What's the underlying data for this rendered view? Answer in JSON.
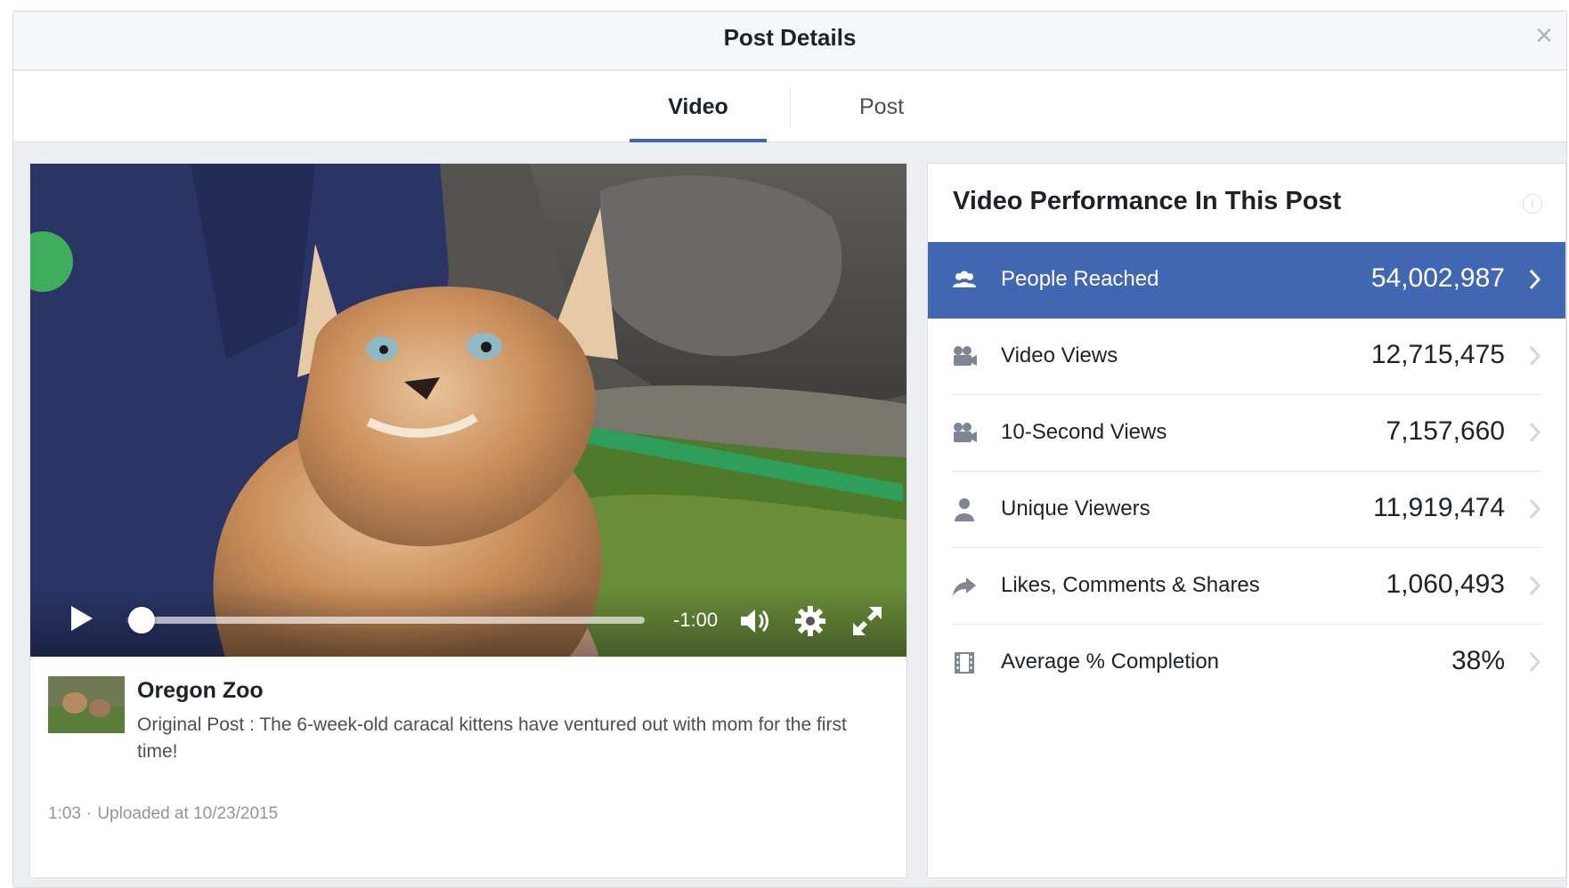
{
  "dialog": {
    "title": "Post Details",
    "close_glyph": "×"
  },
  "tabs": [
    {
      "label": "Video",
      "selected": true
    },
    {
      "label": "Post",
      "selected": false
    }
  ],
  "video_player": {
    "time_remaining": "-1:00",
    "progress_fraction": 0.03,
    "icons": [
      "play-icon",
      "volume-icon",
      "gear-icon",
      "fullscreen-icon"
    ]
  },
  "post": {
    "author": "Oregon Zoo",
    "text": "Original Post : The 6-week-old caracal kittens have ventured out with mom for the first time!",
    "duration": "1:03",
    "separator": "·",
    "uploaded": "Uploaded at 10/23/2015"
  },
  "performance": {
    "title": "Video Performance In This Post",
    "info_glyph": "i",
    "accent_color": "#4267b2",
    "metrics": [
      {
        "icon": "people-icon",
        "label": "People Reached",
        "value": "54,002,987",
        "active": true
      },
      {
        "icon": "video-camera-icon",
        "label": "Video Views",
        "value": "12,715,475",
        "active": false
      },
      {
        "icon": "video-camera-icon",
        "label": "10-Second Views",
        "value": "7,157,660",
        "active": false
      },
      {
        "icon": "person-icon",
        "label": "Unique Viewers",
        "value": "11,919,474",
        "active": false
      },
      {
        "icon": "share-icon",
        "label": "Likes, Comments & Shares",
        "value": "1,060,493",
        "active": false
      },
      {
        "icon": "film-icon",
        "label": "Average % Completion",
        "value": "38%",
        "active": false
      }
    ]
  }
}
